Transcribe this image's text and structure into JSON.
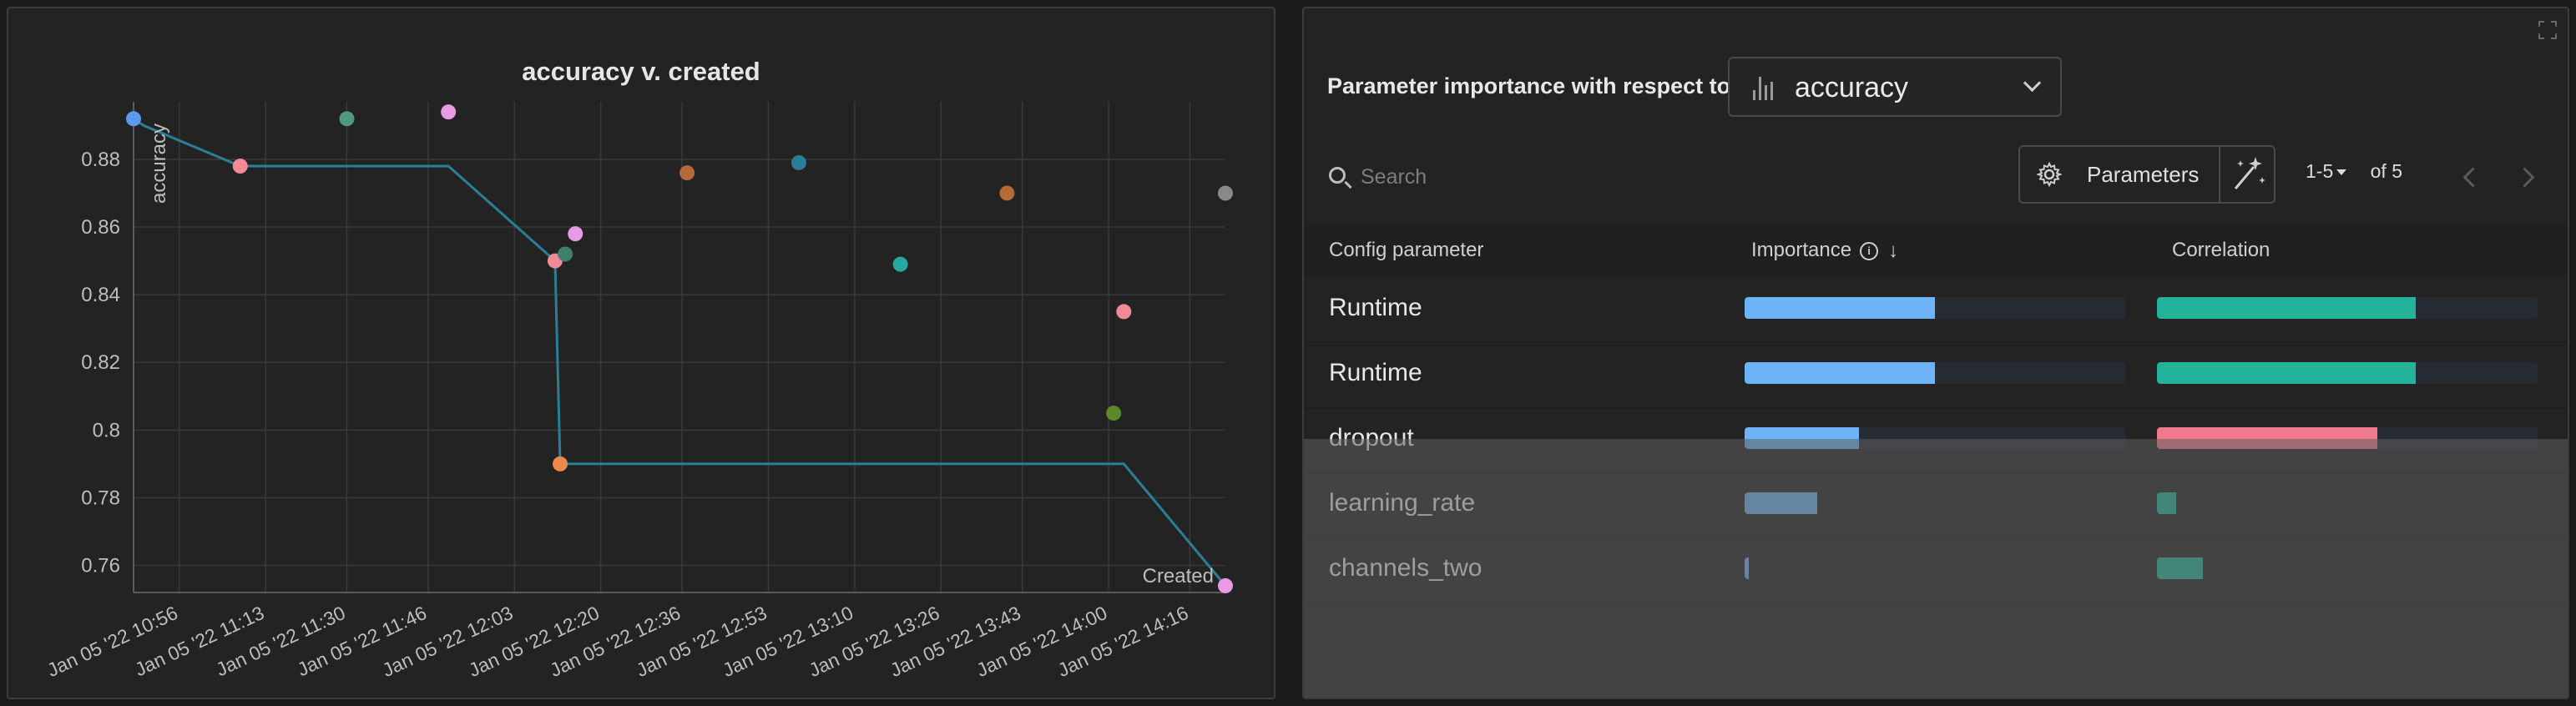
{
  "chart_data": {
    "type": "scatter",
    "title": "accuracy v. created",
    "ylabel": "accuracy",
    "xlabel": "Created",
    "ylim": [
      0.752,
      0.897
    ],
    "yticks": [
      0.76,
      0.78,
      0.8,
      0.82,
      0.84,
      0.86,
      0.88
    ],
    "ytick_labels": [
      "0.76",
      "0.78",
      "0.8",
      "0.82",
      "0.84",
      "0.86",
      "0.88"
    ],
    "xlim": [
      0,
      215
    ],
    "xticks": [
      9,
      26,
      42,
      58,
      75,
      92,
      108,
      125,
      142,
      159,
      175,
      192,
      208
    ],
    "xtick_labels": [
      "Jan 05 '22 10:56",
      "Jan 05 '22 11:13",
      "Jan 05 '22 11:30",
      "Jan 05 '22 11:46",
      "Jan 05 '22 12:03",
      "Jan 05 '22 12:20",
      "Jan 05 '22 12:36",
      "Jan 05 '22 12:53",
      "Jan 05 '22 13:10",
      "Jan 05 '22 13:26",
      "Jan 05 '22 13:43",
      "Jan 05 '22 14:00",
      "Jan 05 '22 14:16"
    ],
    "points": [
      {
        "x": 0,
        "y": 0.892,
        "color": "#5b9bef"
      },
      {
        "x": 21,
        "y": 0.878,
        "color": "#f08b95"
      },
      {
        "x": 42,
        "y": 0.892,
        "color": "#4f9a7c"
      },
      {
        "x": 62,
        "y": 0.894,
        "color": "#e99ae6"
      },
      {
        "x": 83,
        "y": 0.85,
        "color": "#f08b95"
      },
      {
        "x": 85,
        "y": 0.852,
        "color": "#3f7f6f"
      },
      {
        "x": 87,
        "y": 0.858,
        "color": "#e99ae6"
      },
      {
        "x": 84,
        "y": 0.79,
        "color": "#ee8a48"
      },
      {
        "x": 109,
        "y": 0.876,
        "color": "#b56a3a"
      },
      {
        "x": 131,
        "y": 0.879,
        "color": "#2a7f96"
      },
      {
        "x": 151,
        "y": 0.849,
        "color": "#27a7a0"
      },
      {
        "x": 172,
        "y": 0.87,
        "color": "#b56a3a"
      },
      {
        "x": 193,
        "y": 0.805,
        "color": "#5a8a2a"
      },
      {
        "x": 195,
        "y": 0.835,
        "color": "#f08b95"
      },
      {
        "x": 215,
        "y": 0.87,
        "color": "#8a8a8a"
      },
      {
        "x": 215,
        "y": 0.754,
        "color": "#e99ae6"
      }
    ],
    "best_line": {
      "x": [
        0,
        2,
        21,
        62,
        83,
        84,
        195,
        215
      ],
      "y": [
        0.892,
        0.89,
        0.878,
        0.878,
        0.85,
        0.79,
        0.79,
        0.754
      ],
      "color": "#2a7f96"
    }
  },
  "importance_panel": {
    "header_label": "Parameter importance with respect to",
    "metric_value": "accuracy",
    "search_placeholder": "Search",
    "parameters_button": "Parameters",
    "pager_range": "1-5",
    "pager_total": "of 5",
    "columns": {
      "parameter": "Config parameter",
      "importance": "Importance",
      "correlation": "Correlation"
    },
    "rows": [
      {
        "name": "Runtime",
        "importance": 0.5,
        "correlation": 0.68,
        "correlation_color": "#22b39a"
      },
      {
        "name": "Runtime",
        "importance": 0.5,
        "correlation": 0.68,
        "correlation_color": "#22b39a"
      },
      {
        "name": "dropout",
        "importance": 0.3,
        "correlation": 0.58,
        "correlation_color": "#f07a8c"
      },
      {
        "name": "learning_rate",
        "importance": 0.19,
        "correlation": 0.05,
        "correlation_color": "#22b39a"
      },
      {
        "name": "channels_two",
        "importance": 0.01,
        "correlation": 0.12,
        "correlation_color": "#22b39a"
      }
    ],
    "importance_color": "#6fb3f7"
  }
}
